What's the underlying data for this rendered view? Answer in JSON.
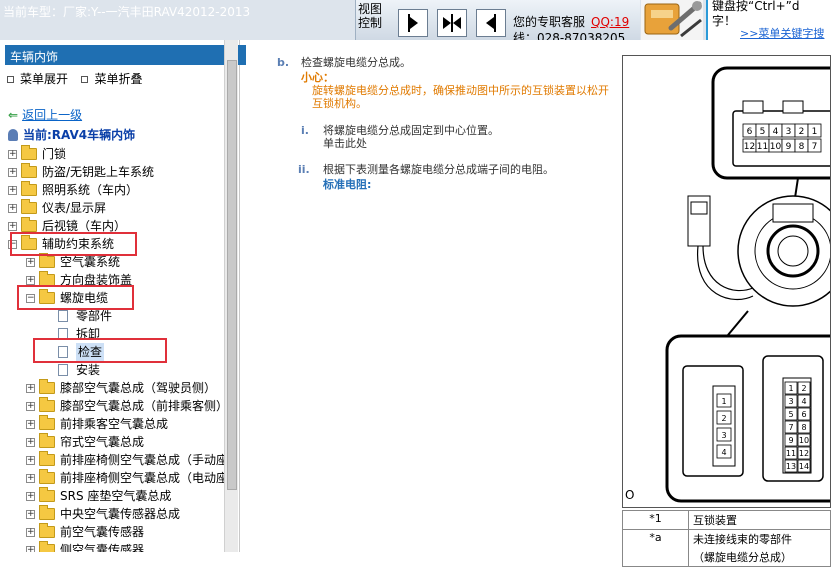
{
  "header": {
    "car_title": "当前车型：厂家:Y--一汽丰田RAV42012-2013",
    "view_label": "视图控制",
    "service_prefix": "您的专职客服",
    "service_qq": "QQ:19",
    "service_line2": "线：028-87038205",
    "ad_line1": "键盘按“Ctrl+”d",
    "ad_line2": "字！",
    "ad_link": ">>菜单关键字搜"
  },
  "sidebar": {
    "section_title": "车辆内饰",
    "expand_label": "菜单展开",
    "collapse_label": "菜单折叠",
    "back_link": "返回上一级",
    "current_node": "当前:RAV4车辆内饰",
    "tree": {
      "n1": "门锁",
      "n2": "防盗/无钥匙上车系统",
      "n3": "照明系统（车内）",
      "n4": "仪表/显示屏",
      "n5": "后视镜（车内）",
      "n6": "辅助约束系统",
      "n6_1": "空气囊系统",
      "n6_2": "方向盘装饰盖",
      "n6_3": "螺旋电缆",
      "n6_3_1": "零部件",
      "n6_3_2": "拆卸",
      "n6_3_3": "检查",
      "n6_3_4": "安装",
      "n6_4": "膝部空气囊总成（驾驶员侧）",
      "n6_5": "膝部空气囊总成（前排乘客侧）",
      "n6_6": "前排乘客空气囊总成",
      "n6_7": "帘式空气囊总成",
      "n6_8": "前排座椅侧空气囊总成（手动座椅",
      "n6_9": "前排座椅侧空气囊总成（电动座椅",
      "n6_10": "SRS 座垫空气囊总成",
      "n6_11": "中央空气囊传感器总成",
      "n6_12": "前空气囊传感器",
      "n6_13": "侧空气囊传感器"
    }
  },
  "content": {
    "step_b_marker": "b.",
    "step_b_text": "检查螺旋电缆分总成。",
    "caution_title": "小心：",
    "caution_line1": "旋转螺旋电缆分总成时，确保推动图中所示的互锁装置以松开",
    "caution_line2": "互锁机构。",
    "sub_i_marker": "i.",
    "sub_i_line1": "将螺旋电缆分总成固定到中心位置。",
    "sub_i_line2": "单击此处",
    "sub_ii_marker": "ii.",
    "sub_ii_text": "根据下表测量各螺旋电缆分总成端子间的电阻。",
    "standard_label": "标准电阻:"
  },
  "diagram": {
    "o_label": "O",
    "connector_top_row1": [
      "6",
      "5",
      "4",
      "3",
      "2",
      "1"
    ],
    "connector_top_row2": [
      "12",
      "11",
      "10",
      "9",
      "8",
      "7"
    ],
    "connector_a_pins": [
      "1",
      "2",
      "3",
      "4"
    ],
    "connector_b_pins": [
      "1",
      "2",
      "3",
      "4",
      "5",
      "6",
      "7",
      "8",
      "9",
      "10",
      "11",
      "12",
      "13",
      "14"
    ]
  },
  "legend": [
    {
      "key": "*1",
      "value": "互锁装置"
    },
    {
      "key": "*a",
      "value": "未连接线束的零部件"
    },
    {
      "key": "",
      "value": "（螺旋电缆分总成）"
    }
  ],
  "colors": {
    "accent_blue": "#1f6fb2",
    "highlight_red": "#e0303a",
    "caution_orange": "#e07a00"
  }
}
